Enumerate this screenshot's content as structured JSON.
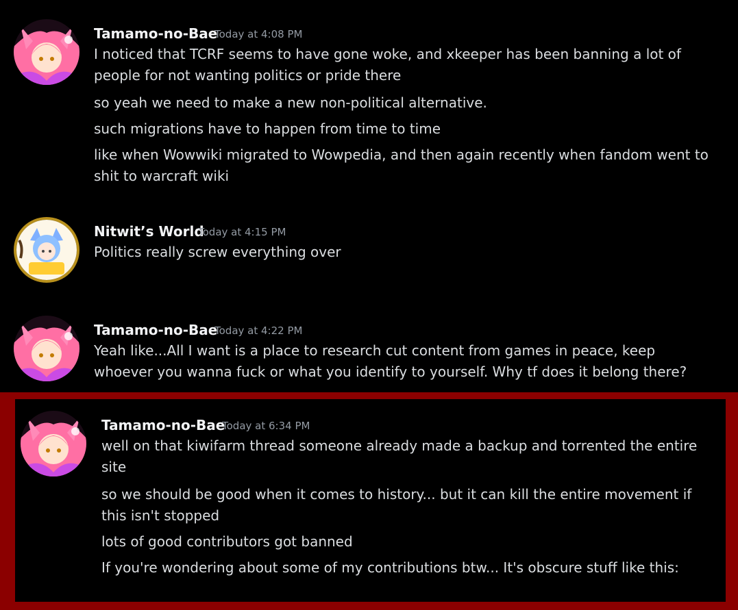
{
  "messages": [
    {
      "author": "Tamamo-no-Bae",
      "timestamp": "Today at 4:08 PM",
      "lines": [
        "I noticed that TCRF seems to have gone woke, and xkeeper has been banning a lot of people for not wanting politics or pride there",
        "so yeah we need to make a new non-political alternative.",
        "such migrations have to happen from time to time",
        "like when Wowwiki migrated to Wowpedia, and then again recently when fandom went to shit to warcraft wiki"
      ]
    },
    {
      "author": "Nitwit’s World",
      "timestamp": "Today at 4:15 PM",
      "lines": [
        "Politics really screw everything over"
      ]
    },
    {
      "author": "Tamamo-no-Bae",
      "timestamp": "Today at 4:22 PM",
      "lines": [
        "Yeah like...All I want is a place to research cut content from games in peace, keep whoever you wanna fuck or what you identify to yourself. Why tf does it belong there?"
      ]
    },
    {
      "author": "Tamamo-no-Bae",
      "timestamp": "Today at 6:34 PM",
      "lines": [
        "well on that kiwifarm thread someone already made a backup and torrented the entire site",
        "so we should be good when it comes to history... but it can kill the entire movement if this isn't stopped",
        "lots of good contributors got banned",
        "If you're wondering about some of my contributions btw... It's obscure stuff like this:"
      ]
    }
  ]
}
